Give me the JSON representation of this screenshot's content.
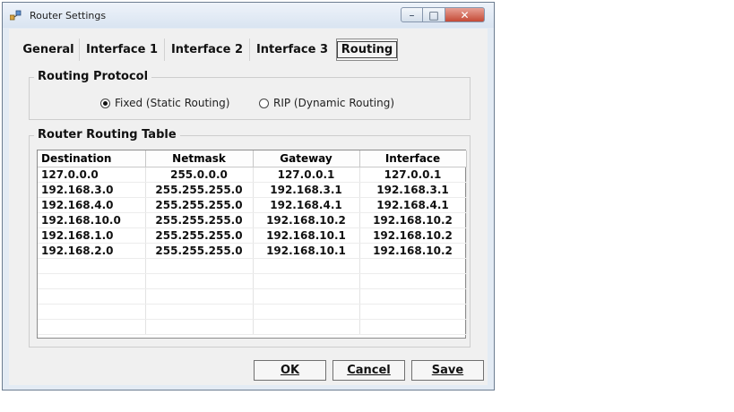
{
  "window": {
    "title": "Router Settings"
  },
  "tabs": [
    {
      "label": "General"
    },
    {
      "label": "Interface 1"
    },
    {
      "label": "Interface 2"
    },
    {
      "label": "Interface 3"
    },
    {
      "label": "Routing",
      "selected": true
    }
  ],
  "routing_protocol": {
    "title": "Routing Protocol",
    "options": [
      {
        "label": "Fixed (Static Routing)",
        "checked": true
      },
      {
        "label": "RIP (Dynamic Routing)",
        "checked": false
      }
    ]
  },
  "routing_table": {
    "title": "Router Routing Table",
    "columns": [
      "Destination",
      "Netmask",
      "Gateway",
      "Interface"
    ],
    "rows": [
      [
        "127.0.0.0",
        "255.0.0.0",
        "127.0.0.1",
        "127.0.0.1"
      ],
      [
        "192.168.3.0",
        "255.255.255.0",
        "192.168.3.1",
        "192.168.3.1"
      ],
      [
        "192.168.4.0",
        "255.255.255.0",
        "192.168.4.1",
        "192.168.4.1"
      ],
      [
        "192.168.10.0",
        "255.255.255.0",
        "192.168.10.2",
        "192.168.10.2"
      ],
      [
        "192.168.1.0",
        "255.255.255.0",
        "192.168.10.1",
        "192.168.10.2"
      ],
      [
        "192.168.2.0",
        "255.255.255.0",
        "192.168.10.1",
        "192.168.10.2"
      ]
    ]
  },
  "buttons": {
    "ok": "OK",
    "cancel": "Cancel",
    "save": "Save"
  },
  "colors": {
    "close_button": "#c44a36",
    "client_bg": "#f0f0f0",
    "grid_bg": "#ffffff"
  }
}
